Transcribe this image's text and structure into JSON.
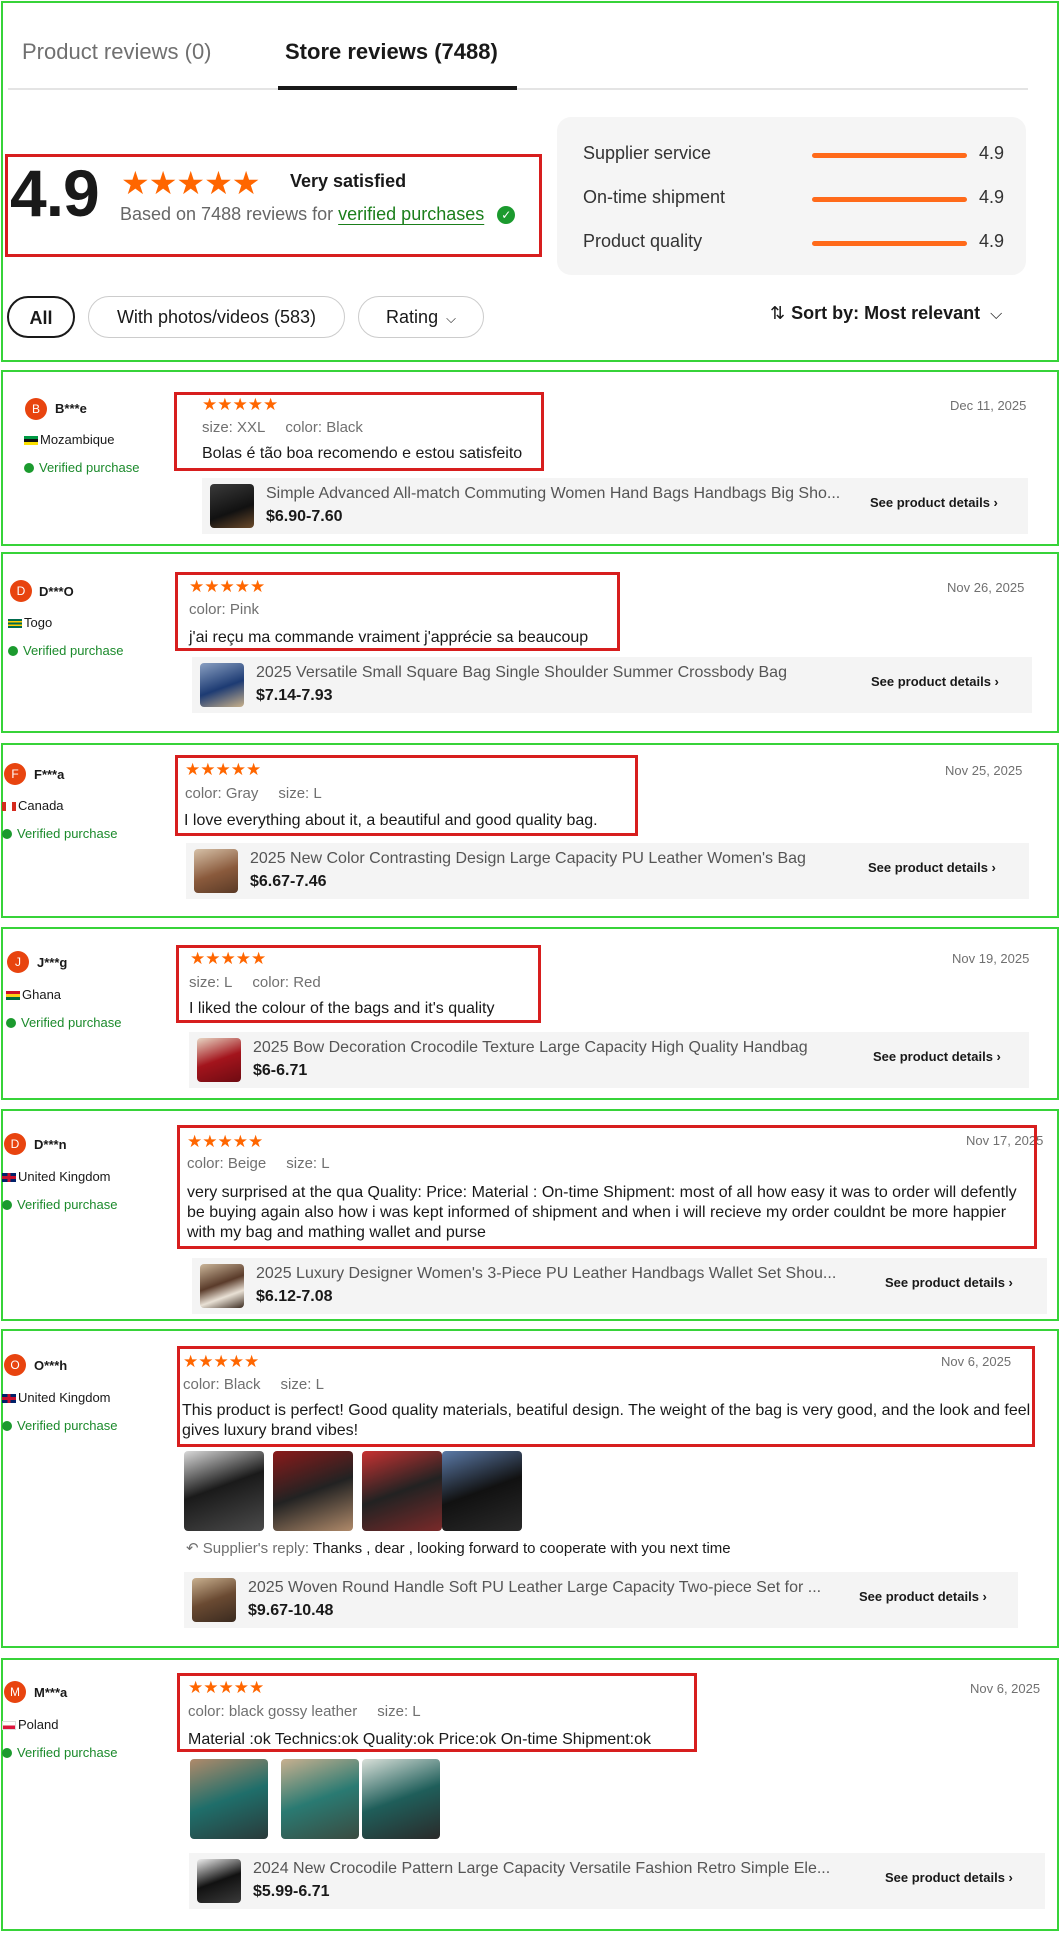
{
  "tabs": {
    "product": "Product reviews (0)",
    "store": "Store reviews (7488)"
  },
  "summary": {
    "score": "4.9",
    "stars": "★★★★★",
    "label": "Very satisfied",
    "based_prefix": "Based on 7488 reviews for",
    "verified_link": "verified purchases",
    "check": "✓"
  },
  "ratings": [
    {
      "label": "Supplier service",
      "value": "4.9"
    },
    {
      "label": "On-time shipment",
      "value": "4.9"
    },
    {
      "label": "Product quality",
      "value": "4.9"
    }
  ],
  "filters": {
    "all": "All",
    "photos": "With photos/videos (583)",
    "rating": "Rating",
    "chevron": "⌵"
  },
  "sort": {
    "icon": "⇅",
    "label": "Sort by: Most relevant",
    "chevron": "⌵"
  },
  "common": {
    "verified": "Verified purchase",
    "see_details": "See product details ›",
    "reply_label": "Supplier's reply:",
    "reply_icon": "↶"
  },
  "colors": {
    "accent": "#ff6600",
    "verified": "#1b8a2b",
    "frame": "#37d339",
    "highlight": "#d71e1e"
  },
  "reviews": [
    {
      "initial": "B",
      "name": "B***e",
      "country": "Mozambique",
      "date": "Dec 11, 2025",
      "stars": "★★★★★",
      "attrs": [
        [
          "size:",
          "XXL"
        ],
        [
          "color:",
          "Black"
        ]
      ],
      "text": "Bolas é tão boa recomendo e estou satisfeito",
      "product_title": "Simple Advanced All-match Commuting Women Hand Bags Handbags Big Sho...",
      "price": "$6.90-7.60"
    },
    {
      "initial": "D",
      "name": "D***O",
      "country": "Togo",
      "date": "Nov 26, 2025",
      "stars": "★★★★★",
      "attrs": [
        [
          "color:",
          "Pink"
        ]
      ],
      "text": "j'ai reçu ma commande vraiment j'apprécie sa beaucoup",
      "product_title": "2025 Versatile Small Square Bag Single Shoulder Summer Crossbody Bag",
      "price": "$7.14-7.93"
    },
    {
      "initial": "F",
      "name": "F***a",
      "country": "Canada",
      "date": "Nov 25, 2025",
      "stars": "★★★★★",
      "attrs": [
        [
          "color:",
          "Gray"
        ],
        [
          "size:",
          "L"
        ]
      ],
      "text": "I love everything about it, a beautiful and good quality bag.",
      "product_title": "2025 New Color Contrasting Design Large Capacity PU Leather Women's Bag",
      "price": "$6.67-7.46"
    },
    {
      "initial": "J",
      "name": "J***g",
      "country": "Ghana",
      "date": "Nov 19, 2025",
      "stars": "★★★★★",
      "attrs": [
        [
          "size:",
          "L"
        ],
        [
          "color:",
          "Red"
        ]
      ],
      "text": "I liked the colour of the bags and it's quality",
      "product_title": "2025 Bow Decoration Crocodile Texture Large Capacity High Quality Handbag",
      "price": "$6-6.71"
    },
    {
      "initial": "D",
      "name": "D***n",
      "country": "United Kingdom",
      "date": "Nov 17, 2025",
      "stars": "★★★★★",
      "attrs": [
        [
          "color:",
          "Beige"
        ],
        [
          "size:",
          "L"
        ]
      ],
      "text": "very surprised at the qua Quality: Price: Material : On-time Shipment: most of all how easy it was to order will defently be buying again also how i was kept informed of shipment and when i will recieve my order couldnt be more happier with my bag and mathing wallet and purse",
      "product_title": "2025 Luxury Designer Women's 3-Piece PU Leather Handbags Wallet Set Shou...",
      "price": "$6.12-7.08"
    },
    {
      "initial": "O",
      "name": "O***h",
      "country": "United Kingdom",
      "date": "Nov 6, 2025",
      "stars": "★★★★★",
      "attrs": [
        [
          "color:",
          "Black"
        ],
        [
          "size:",
          "L"
        ]
      ],
      "text": "This product is perfect! Good quality materials, beatiful design. The weight of the bag is very good, and the look and feel gives luxury brand vibes!",
      "reply": "Thanks , dear , looking forward to cooperate with you next time",
      "product_title": "2025 Woven Round Handle Soft PU Leather Large Capacity Two-piece Set for ...",
      "price": "$9.67-10.48"
    },
    {
      "initial": "M",
      "name": "M***a",
      "country": "Poland",
      "date": "Nov 6, 2025",
      "stars": "★★★★★",
      "attrs": [
        [
          "color:",
          "black gossy leather"
        ],
        [
          "size:",
          "L"
        ]
      ],
      "text": "Material :ok Technics:ok Quality:ok Price:ok On-time Shipment:ok",
      "product_title": "2024 New Crocodile Pattern Large Capacity Versatile Fashion Retro Simple Ele...",
      "price": "$5.99-6.71"
    }
  ]
}
